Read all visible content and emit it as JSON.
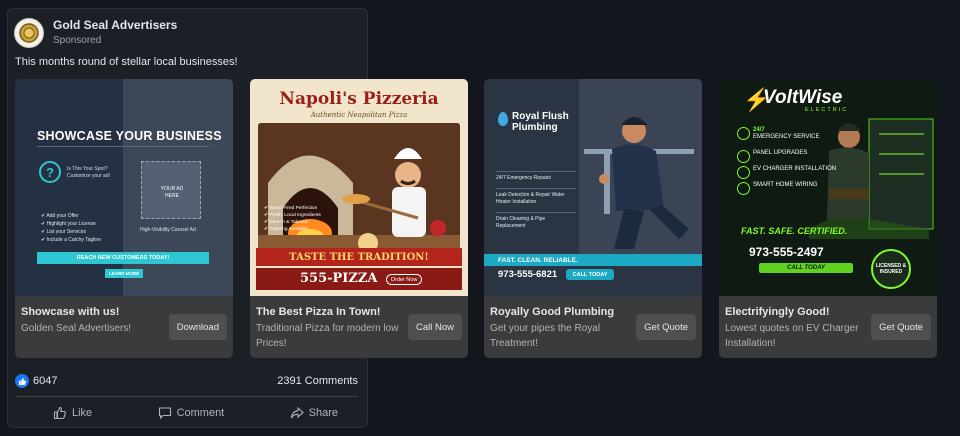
{
  "post": {
    "advertiser": "Gold Seal Advertisers",
    "sponsored": "Sponsored",
    "caption": "This months round of stellar local businesses!",
    "reactions_count": "6047",
    "comments_count": "2391 Comments",
    "actions": {
      "like": "Like",
      "comment": "Comment",
      "share": "Share"
    }
  },
  "cards": [
    {
      "title": "Showcase with us!",
      "subtitle": "Golden Seal Advertisers!",
      "button": "Download",
      "image": {
        "headline": "SHOWCASE YOUR BUSINESS",
        "spot_line1": "Is This Your Spot?",
        "spot_line2": "Customize your ad!",
        "box_label": "YOUR AD HERE",
        "bullets": [
          "Add your Offer",
          "Highlight your License",
          "List your Services",
          "Include a Catchy Tagline"
        ],
        "visibility": "High-Visibility Carosel Ad",
        "reach": "REACH NEW CUSTOMERS TODAY!",
        "learn": "LEARN MORE"
      }
    },
    {
      "title": "The Best Pizza In Town!",
      "subtitle": "Traditional Pizza for modern low Prices!",
      "button": "Call Now",
      "image": {
        "name": "Napoli's Pizzeria",
        "tagline": "Authentic Neapolitan Pizza",
        "features": [
          "Wood-Fired Perfection",
          "Fresh, Local Ingredients",
          "Dine-In & Takeout",
          "Catering Available"
        ],
        "banner": "TASTE THE TRADITION!",
        "phone": "555-PIZZA",
        "order": "Order Now"
      }
    },
    {
      "title": "Royally Good Plumbing",
      "subtitle": "Get your pipes the Royal Treatment!",
      "button": "Get Quote",
      "image": {
        "brand_line1": "Royal Flush",
        "brand_line2": "Plumbing",
        "services": [
          "24/7 Emergency Repairs",
          "Leak Detection & Repair Water Heater Installation",
          "Drain Cleaning & Pipe Replacement"
        ],
        "band": "FAST. CLEAN. RELIABLE.",
        "phone": "973-555-6821",
        "call": "CALL TODAY"
      }
    },
    {
      "title": "Electrifyingly Good!",
      "subtitle": "Lowest quotes on EV Charger Installation!",
      "button": "Get Quote",
      "image": {
        "brand": "VoltWise",
        "brand_sub": "ELECTRIC",
        "services": [
          {
            "big": "24/7",
            "text": "EMERGENCY SERVICE"
          },
          {
            "big": "",
            "text": "PANEL UPGRADES"
          },
          {
            "big": "",
            "text": "EV CHARGER INSTALLATION"
          },
          {
            "big": "",
            "text": "SMART HOME WIRING"
          }
        ],
        "slogan_a": "FAST.",
        "slogan_b": "SAFE.",
        "slogan_c": "CERTIFIED.",
        "phone": "973-555-2497",
        "call": "CALL TODAY",
        "badge": "LICENSED & INSURED"
      }
    }
  ],
  "colors": {
    "accent_blue": "#1877f2",
    "card_bg": "#3a3b3c",
    "page_bg": "#13171d"
  }
}
